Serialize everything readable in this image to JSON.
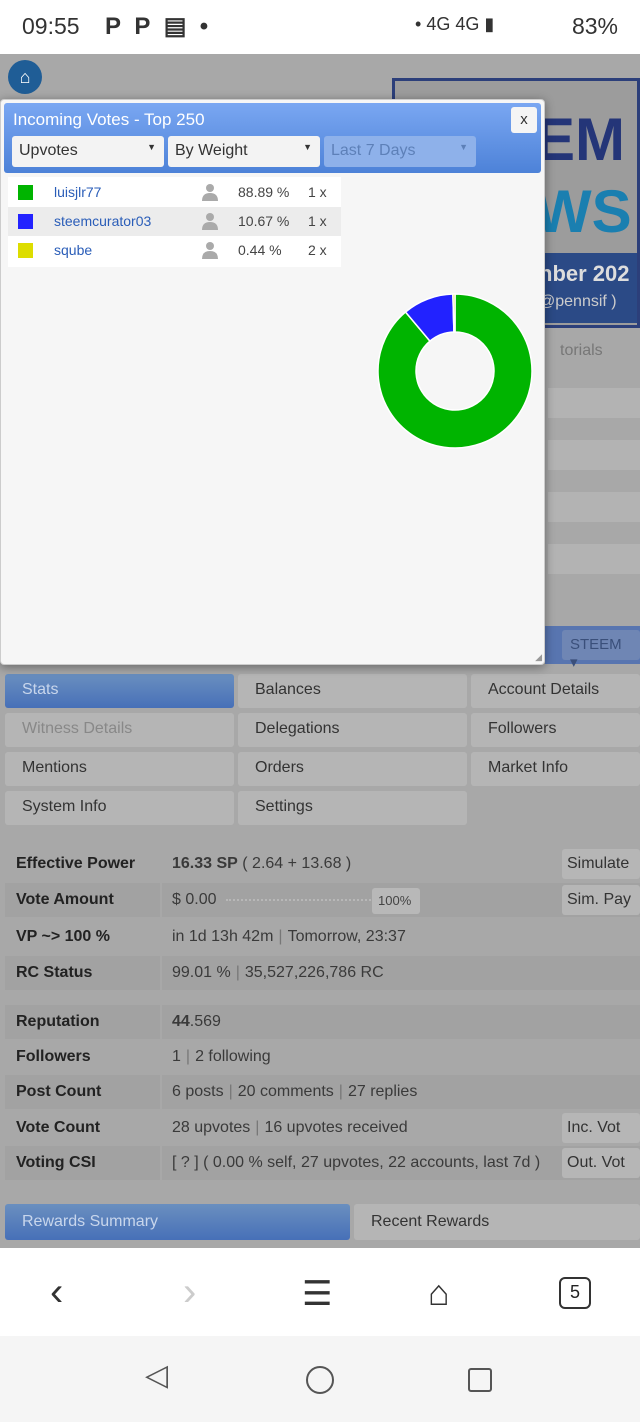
{
  "status_bar": {
    "time": "09:55",
    "network": "4G 4G",
    "battery": "83%"
  },
  "background": {
    "banner_line1": "EM",
    "banner_line2": "WS",
    "banner_date": "nber 202",
    "banner_author": "@pennsif )",
    "ghost_menu": "torials",
    "currency_select": "STEEM"
  },
  "tabs": [
    {
      "label": "Stats",
      "active": true
    },
    {
      "label": "Balances"
    },
    {
      "label": "Account Details"
    },
    {
      "label": "Witness Details",
      "disabled": true
    },
    {
      "label": "Delegations"
    },
    {
      "label": "Followers"
    },
    {
      "label": "Mentions"
    },
    {
      "label": "Orders"
    },
    {
      "label": "Market Info"
    },
    {
      "label": "System Info"
    },
    {
      "label": "Settings"
    }
  ],
  "stats": {
    "effective_power": {
      "label": "Effective Power",
      "value": "16.33 SP",
      "detail": "( 2.64 + 13.68 )",
      "button": "Simulate"
    },
    "vote_amount": {
      "label": "Vote Amount",
      "value": "$ 0.00",
      "slider_pct": "100%",
      "button": "Sim. Pay"
    },
    "vp": {
      "label": "VP ~> 100 %",
      "value": "in 1d 13h 42m",
      "detail": "Tomorrow, 23:37"
    },
    "rc": {
      "label": "RC Status",
      "value": "99.01 %",
      "detail": "35,527,226,786 RC"
    },
    "reputation": {
      "label": "Reputation",
      "int": "44",
      "dec": ".569"
    },
    "followers": {
      "label": "Followers",
      "value": "1",
      "detail": "2 following"
    },
    "post_count": {
      "label": "Post Count",
      "posts": "6 posts",
      "comments": "20 comments",
      "replies": "27 replies"
    },
    "vote_count": {
      "label": "Vote Count",
      "value": "28 upvotes",
      "detail": "16 upvotes received",
      "button": "Inc. Vot"
    },
    "voting_csi": {
      "label": "Voting CSI",
      "value": "[ ? ] ( 0.00 % self, 27 upvotes, 22 accounts, last 7d )",
      "button": "Out. Vot"
    }
  },
  "rewards_tabs": {
    "summary": "Rewards Summary",
    "recent": "Recent Rewards"
  },
  "dialog": {
    "title": "Incoming Votes - Top 250",
    "close": "x",
    "filters": {
      "type": "Upvotes",
      "sort": "By Weight",
      "period": "Last 7 Days"
    },
    "voters": [
      {
        "name": "luisjlr77",
        "percent": "88.89 %",
        "count": "1 x",
        "color": "#00b400",
        "value": 88.89
      },
      {
        "name": "steemcurator03",
        "percent": "10.67 %",
        "count": "1 x",
        "color": "#2222ff",
        "value": 10.67
      },
      {
        "name": "sqube",
        "percent": "0.44 %",
        "count": "2 x",
        "color": "#dddd00",
        "value": 0.44
      }
    ]
  },
  "nav": {
    "tabs_count": "5"
  }
}
